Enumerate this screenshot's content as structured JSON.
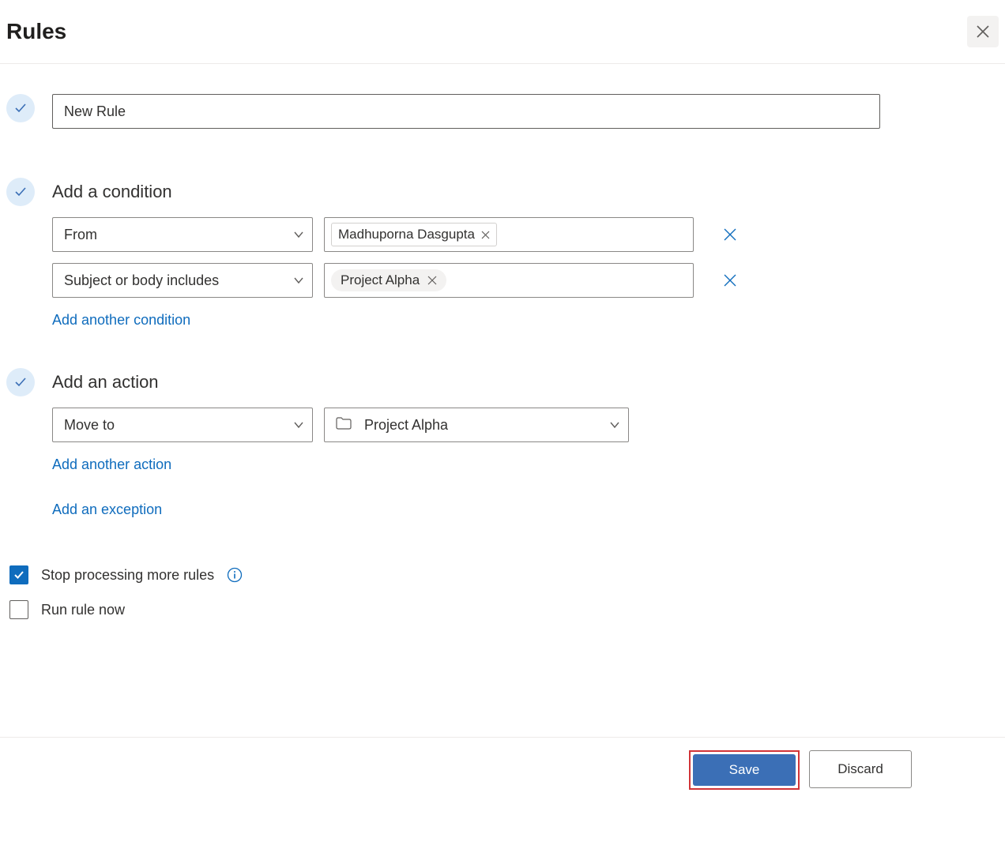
{
  "header": {
    "title": "Rules"
  },
  "rule": {
    "name_value": "New Rule"
  },
  "conditions": {
    "section_title": "Add a condition",
    "items": [
      {
        "field_label": "From",
        "chip_label": "Madhuporna Dasgupta",
        "chip_style": "rect"
      },
      {
        "field_label": "Subject or body includes",
        "chip_label": "Project Alpha",
        "chip_style": "pill"
      }
    ],
    "add_link": "Add another condition"
  },
  "actions": {
    "section_title": "Add an action",
    "items": [
      {
        "field_label": "Move to",
        "folder_label": "Project Alpha"
      }
    ],
    "add_link": "Add another action",
    "exception_link": "Add an exception"
  },
  "options": {
    "stop_processing": {
      "label": "Stop processing more rules",
      "checked": true
    },
    "run_now": {
      "label": "Run rule now",
      "checked": false
    }
  },
  "footer": {
    "save": "Save",
    "discard": "Discard"
  }
}
